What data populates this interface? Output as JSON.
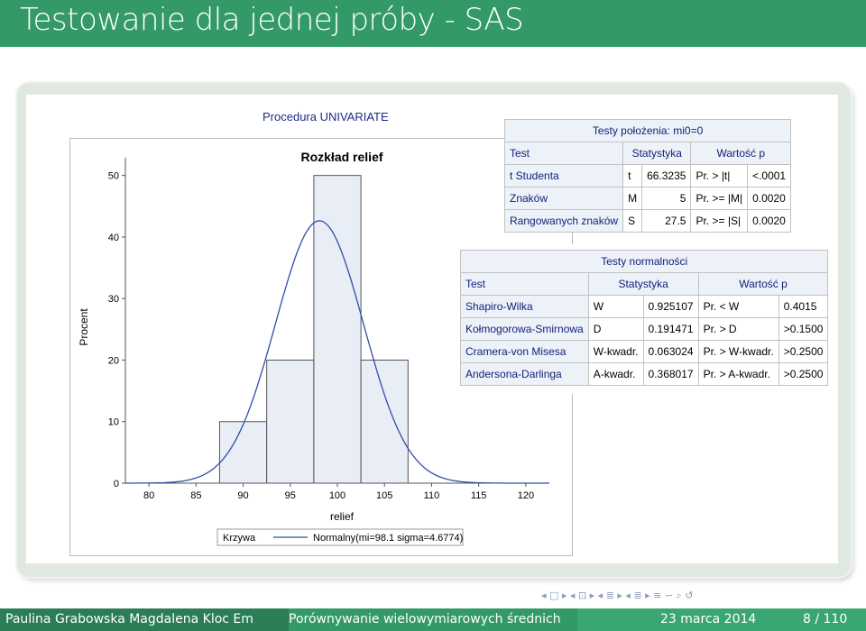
{
  "slide": {
    "title": "Testowanie dla jednej próby - SAS"
  },
  "sas_output": {
    "procedure_title": "Procedura UNIVARIATE"
  },
  "histogram": {
    "title": "Rozkład relief",
    "ylabel": "Procent",
    "xlabel": "relief",
    "legend_label": "Krzywa",
    "legend_entry": "Normalny(mi=98.1 sigma=4.6774)"
  },
  "chart_data": {
    "type": "bar",
    "title": "Rozkład relief",
    "xlabel": "relief",
    "ylabel": "Procent",
    "xlim": [
      77.5,
      122.5
    ],
    "ylim": [
      0,
      52
    ],
    "x_ticks": [
      "80",
      "85",
      "90",
      "95",
      "100",
      "105",
      "110",
      "115",
      "120"
    ],
    "y_ticks": [
      "0",
      "10",
      "20",
      "30",
      "40",
      "50"
    ],
    "bins": [
      {
        "from": 87.5,
        "to": 92.5,
        "value": 10
      },
      {
        "from": 92.5,
        "to": 97.5,
        "value": 20
      },
      {
        "from": 97.5,
        "to": 102.5,
        "value": 50
      },
      {
        "from": 102.5,
        "to": 107.5,
        "value": 20
      }
    ],
    "curve": {
      "name": "Normalny(mi=98.1 sigma=4.6774)",
      "mean": 98.1,
      "sigma": 4.6774,
      "bin_width": 5
    },
    "legend": "bottom",
    "colors": {
      "bars": "#e8edf6",
      "bar_border": "#555555",
      "curve": "#2f4fa8"
    }
  },
  "location_tests": {
    "title": "Testy położenia: mi0=0",
    "headers": [
      "Test",
      "Statystyka",
      "Wartość p"
    ],
    "rows": [
      {
        "test": "t Studenta",
        "sym": "t",
        "stat": "66.3235",
        "pcond": "Pr. > |t|",
        "p": "<.0001"
      },
      {
        "test": "Znaków",
        "sym": "M",
        "stat": "5",
        "pcond": "Pr. >= |M|",
        "p": "0.0020"
      },
      {
        "test": "Rangowanych znaków",
        "sym": "S",
        "stat": "27.5",
        "pcond": "Pr. >= |S|",
        "p": "0.0020"
      }
    ]
  },
  "normality_tests": {
    "title": "Testy normalności",
    "headers": [
      "Test",
      "Statystyka",
      "Wartość p"
    ],
    "rows": [
      {
        "test": "Shapiro-Wilka",
        "sym": "W",
        "stat": "0.925107",
        "pcond": "Pr. < W",
        "p": "0.4015"
      },
      {
        "test": "Kołmogorowa-Smirnowa",
        "sym": "D",
        "stat": "0.191471",
        "pcond": "Pr. > D",
        "p": ">0.1500"
      },
      {
        "test": "Cramera-von Misesa",
        "sym": "W-kwadr.",
        "stat": "0.063024",
        "pcond": "Pr. > W-kwadr.",
        "p": ">0.2500"
      },
      {
        "test": "Andersona-Darlinga",
        "sym": "A-kwadr.",
        "stat": "0.368017",
        "pcond": "Pr. > A-kwadr.",
        "p": ">0.2500"
      }
    ]
  },
  "nav_symbols": "◂ □ ▸   ◂ ⊡ ▸   ◂ ≣ ▸   ◂ ≣ ▸   ≡   ∽ ⌕ ↺",
  "footer": {
    "authors": "Paulina Grabowska  Magdalena Kloc  Em",
    "talk_title": "Porównywanie wielowymiarowych średnich",
    "date": "23 marca 2014",
    "page": "8 / 110"
  }
}
